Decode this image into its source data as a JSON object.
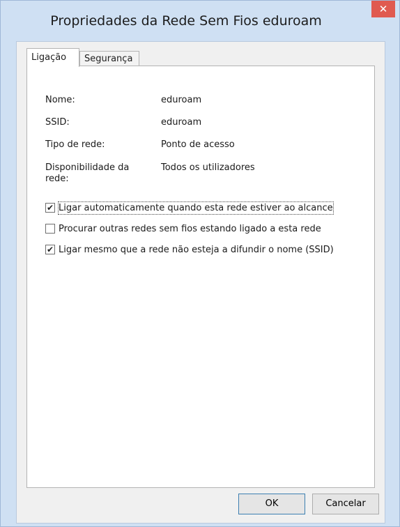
{
  "window": {
    "title": "Propriedades da Rede Sem Fios eduroam",
    "close_glyph": "✕"
  },
  "tabs": [
    {
      "label": "Ligação",
      "active": true
    },
    {
      "label": "Segurança",
      "active": false
    }
  ],
  "details": [
    {
      "label": "Nome:",
      "value": "eduroam"
    },
    {
      "label": "SSID:",
      "value": "eduroam"
    },
    {
      "label": "Tipo de rede:",
      "value": "Ponto de acesso"
    },
    {
      "label": "Disponibilidade da rede:",
      "value": "Todos os utilizadores"
    }
  ],
  "options": [
    {
      "label": "Ligar automaticamente quando esta rede estiver ao alcance",
      "checked": true,
      "glyph": "✔"
    },
    {
      "label": "Procurar outras redes sem fios estando ligado a esta rede",
      "checked": false,
      "glyph": ""
    },
    {
      "label": "Ligar mesmo que a rede não esteja a difundir o nome (SSID)",
      "checked": true,
      "glyph": "✔"
    }
  ],
  "buttons": {
    "ok": "OK",
    "cancel": "Cancelar"
  }
}
